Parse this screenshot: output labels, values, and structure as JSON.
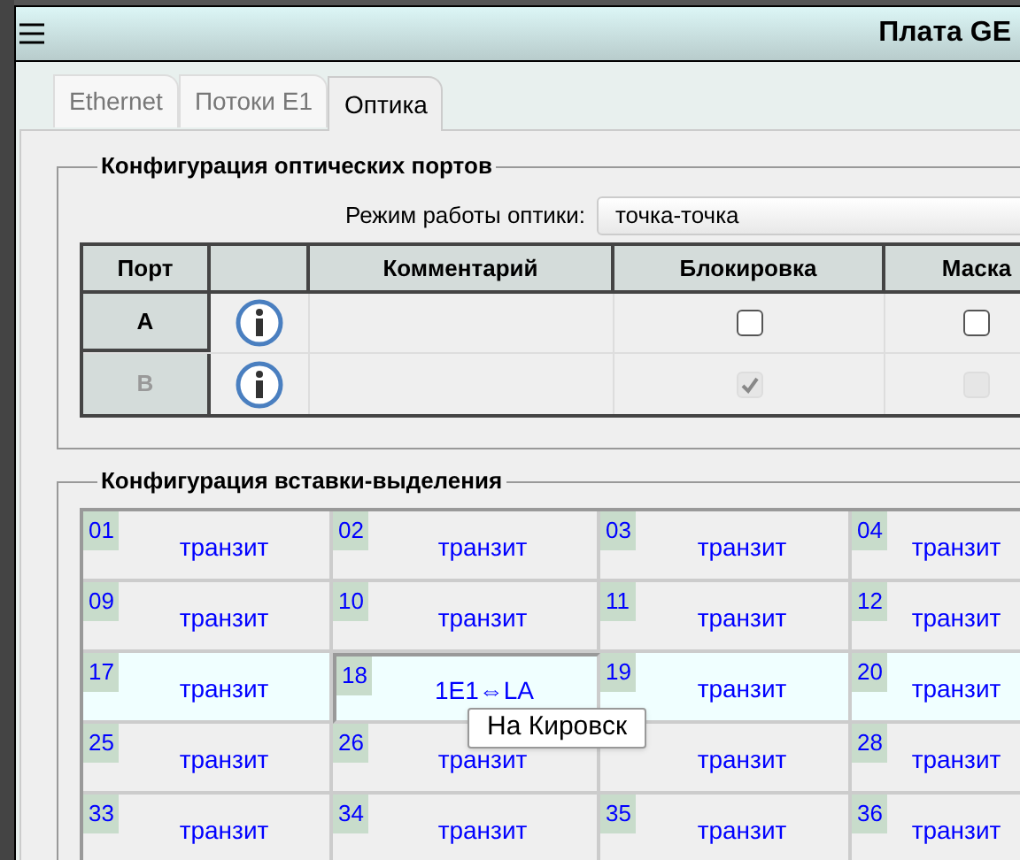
{
  "window": {
    "title": "Плата GE"
  },
  "tabs": [
    {
      "label": "Ethernet",
      "selected": false
    },
    {
      "label": "Потоки E1",
      "selected": false
    },
    {
      "label": "Оптика",
      "selected": true
    }
  ],
  "optics": {
    "legend": "Конфигурация оптических портов",
    "mode_label": "Режим работы оптики:",
    "mode_value": "точка-точка",
    "columns": [
      "Порт",
      "Комментарий",
      "Блокировка",
      "Маска"
    ],
    "rows": [
      {
        "port": "A",
        "disabled": false,
        "blocking": {
          "checked": false,
          "disabled": false
        },
        "mask": {
          "checked": false,
          "disabled": false
        }
      },
      {
        "port": "B",
        "disabled": true,
        "blocking": {
          "checked": true,
          "disabled": true
        },
        "mask": {
          "checked": false,
          "disabled": true
        }
      }
    ]
  },
  "insertion": {
    "legend": "Конфигурация вставки-выделения",
    "rows": [
      {
        "highlighted": false,
        "cells": [
          {
            "number": "01",
            "value": "транзит",
            "selected": false
          },
          {
            "number": "02",
            "value": "транзит",
            "selected": false
          },
          {
            "number": "03",
            "value": "транзит",
            "selected": false
          },
          {
            "number": "04",
            "value": "транзит",
            "selected": false
          }
        ]
      },
      {
        "highlighted": false,
        "cells": [
          {
            "number": "09",
            "value": "транзит",
            "selected": false
          },
          {
            "number": "10",
            "value": "транзит",
            "selected": false
          },
          {
            "number": "11",
            "value": "транзит",
            "selected": false
          },
          {
            "number": "12",
            "value": "транзит",
            "selected": false
          }
        ]
      },
      {
        "highlighted": true,
        "cells": [
          {
            "number": "17",
            "value": "транзит",
            "selected": false
          },
          {
            "number": "18",
            "value": "1E1⇔LA",
            "selected": true
          },
          {
            "number": "19",
            "value": "транзит",
            "selected": false
          },
          {
            "number": "20",
            "value": "транзит",
            "selected": false
          }
        ]
      },
      {
        "highlighted": false,
        "cells": [
          {
            "number": "25",
            "value": "транзит",
            "selected": false
          },
          {
            "number": "26",
            "value": "транзит",
            "selected": false
          },
          {
            "value": "транзит",
            "selected": false
          },
          {
            "number": "28",
            "value": "транзит",
            "selected": false
          }
        ]
      },
      {
        "highlighted": false,
        "cells": [
          {
            "number": "33",
            "value": "транзит",
            "selected": false
          },
          {
            "number": "34",
            "value": "транзит",
            "selected": false
          },
          {
            "number": "35",
            "value": "транзит",
            "selected": false
          },
          {
            "number": "36",
            "value": "транзит",
            "selected": false
          }
        ]
      }
    ]
  },
  "tooltip": {
    "text": "На Кировск"
  }
}
